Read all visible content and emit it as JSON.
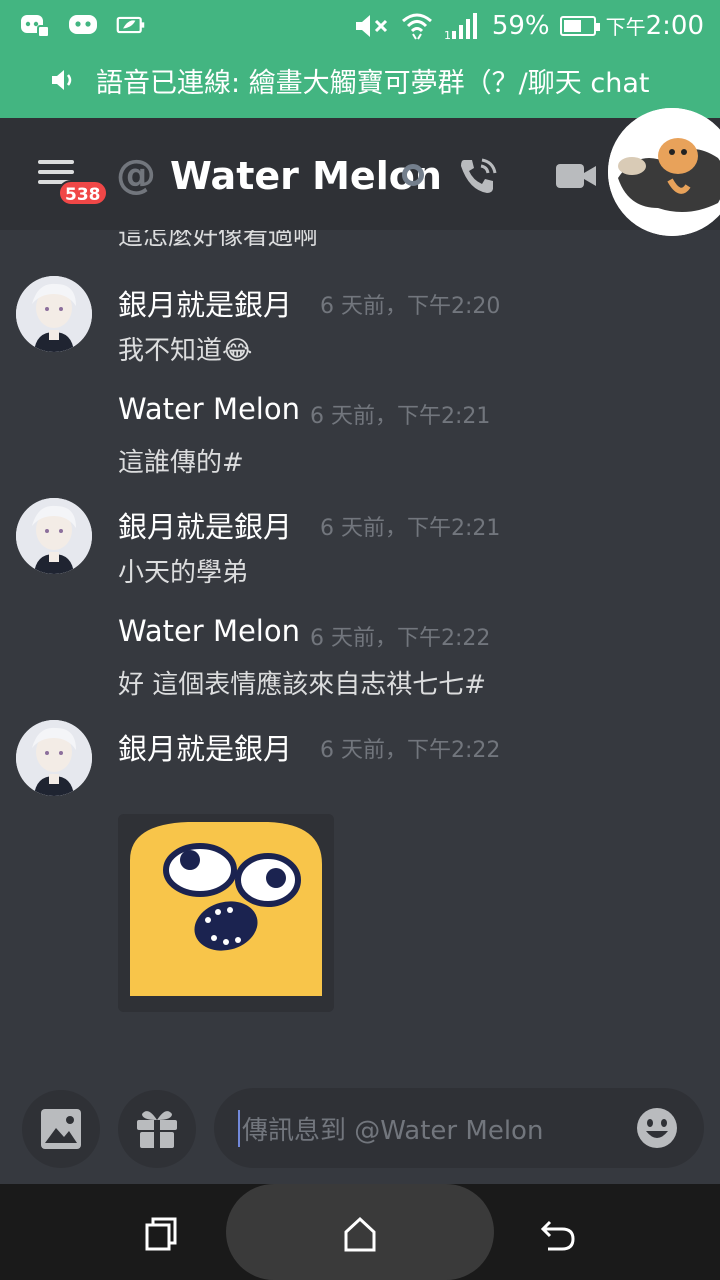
{
  "status_bar": {
    "battery": "59%",
    "time_prefix": "下午",
    "time": "2:00",
    "battery_level": 0.59,
    "icons": [
      "discord-app-icon",
      "discord-icon",
      "battery-saver-icon",
      "mute-icon",
      "wifi-icon",
      "signal-icon"
    ]
  },
  "voice_banner": {
    "text": "語音已連線: 繪畫大觸寶可夢群（？/聊天 chat"
  },
  "header": {
    "unread_count": "538",
    "at_symbol": "@",
    "channel_name": "Water Melon"
  },
  "messages": {
    "cut_text": "這怎麼好像看過啊",
    "items": [
      {
        "author": "銀月就是銀月",
        "time": "6 天前，下午2:20",
        "text": "我不知道😂"
      },
      {
        "author": "Water Melon",
        "time": "6 天前，下午2:21",
        "text": "這誰傳的#"
      },
      {
        "author": "銀月就是銀月",
        "time": "6 天前，下午2:21",
        "text": "小天的學弟"
      },
      {
        "author": "Water Melon",
        "time": "6 天前，下午2:22",
        "text": "好 這個表情應該來自志祺七七#"
      },
      {
        "author": "銀月就是銀月",
        "time": "6 天前，下午2:22",
        "text": ""
      }
    ]
  },
  "input": {
    "placeholder": "傳訊息到 @Water Melon"
  },
  "colors": {
    "voice_green": "#43b581",
    "background": "#36393f",
    "header": "#2f3136",
    "badge_red": "#f04747",
    "sticker_yellow": "#f8c54a"
  }
}
